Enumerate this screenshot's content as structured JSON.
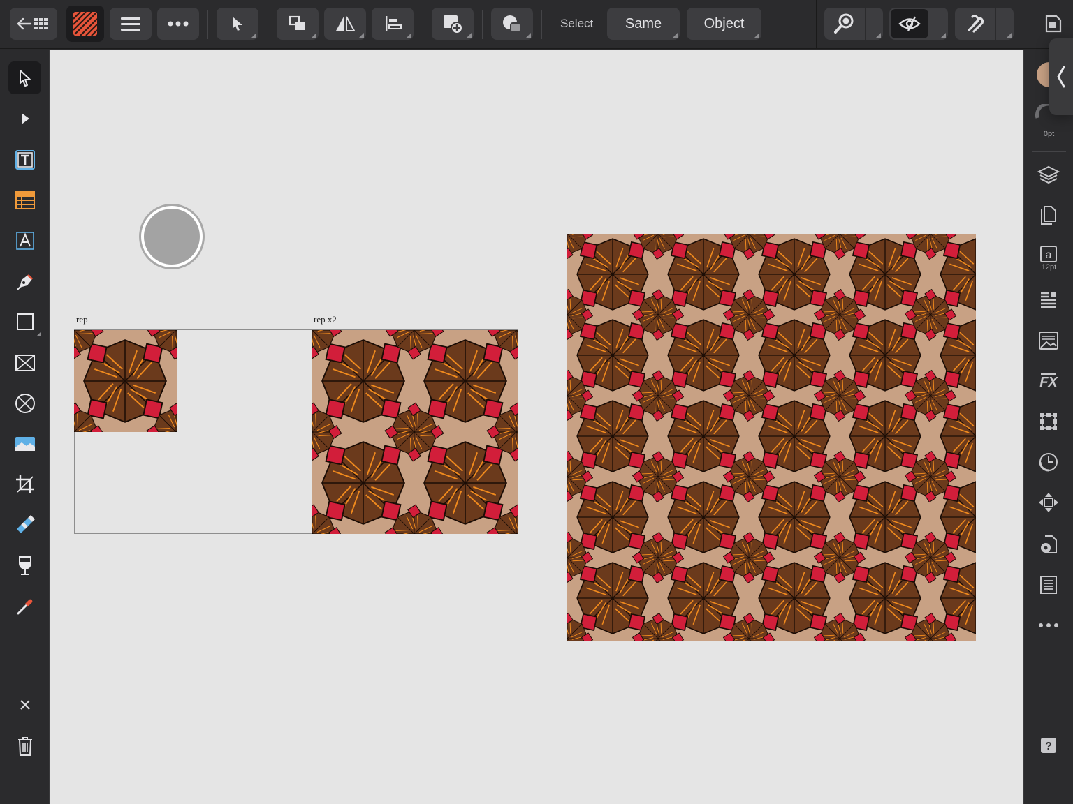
{
  "toolbar": {
    "select_label": "Select",
    "same_label": "Same",
    "object_label": "Object"
  },
  "rightpanel": {
    "stroke_width": "0pt",
    "font_size": "12pt"
  },
  "canvas": {
    "artboard_rep_label": "rep",
    "artboard_repx2_label": "rep x2"
  },
  "colors": {
    "accent": "#e8553b",
    "pattern_bg": "#c8a184",
    "pattern_brown": "#6b3a1c",
    "pattern_red": "#d21e3a",
    "pattern_orange": "#f08a1d"
  },
  "icons": {
    "top": [
      "back-grid-icon",
      "app-logo-icon",
      "menu-icon",
      "more-icon",
      "move-tool-icon",
      "arrange-icon",
      "flip-icon",
      "align-icon",
      "add-shape-icon",
      "boolean-icon",
      "zoom-icon",
      "view-mode-icon",
      "snapping-icon",
      "document-icon"
    ],
    "left": [
      "move-pointer-icon",
      "node-pointer-icon",
      "frame-text-icon",
      "table-icon",
      "artistic-text-icon",
      "pen-icon",
      "rectangle-icon",
      "picture-frame-icon",
      "ellipse-frame-icon",
      "image-icon",
      "crop-icon",
      "fill-tool-icon",
      "transparency-icon",
      "color-picker-icon",
      "close-icon",
      "trash-icon"
    ],
    "right": [
      "color-swatch-icon",
      "stroke-icon",
      "layers-icon",
      "pages-icon",
      "character-icon",
      "paragraph-icon",
      "text-styles-icon",
      "effects-icon",
      "transform-icon",
      "history-icon",
      "navigator-icon",
      "document-settings-icon",
      "text-frame-icon",
      "more-icon",
      "help-icon"
    ]
  }
}
